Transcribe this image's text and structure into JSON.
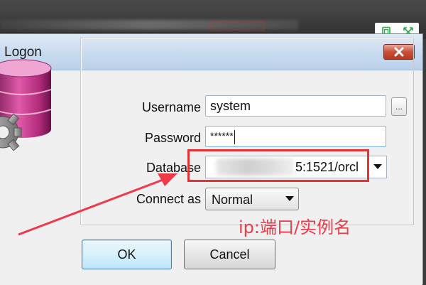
{
  "dialog": {
    "title": "Logon",
    "fields": {
      "username_label": "Username",
      "username_value": "system",
      "password_label": "Password",
      "password_value": "******",
      "database_label": "Database",
      "database_value": "5:1521/orcl",
      "connect_as_label": "Connect as",
      "connect_as_value": "Normal"
    },
    "ellipsis_label": "...",
    "buttons": {
      "ok": "OK",
      "cancel": "Cancel"
    }
  },
  "annotation": {
    "text": "ip:端口/实例名",
    "color": "#ef3a4a"
  },
  "icons": {
    "close": "close-x-icon",
    "database": "database-gear-icon",
    "dropdown": "dropdown-arrow-icon",
    "toolbar": [
      "copy-icon",
      "expand-icon"
    ]
  },
  "colors": {
    "accent_red": "#e53333",
    "titlebar_blue": "#c6d9ee",
    "toolbar_green": "#2ea84a"
  }
}
